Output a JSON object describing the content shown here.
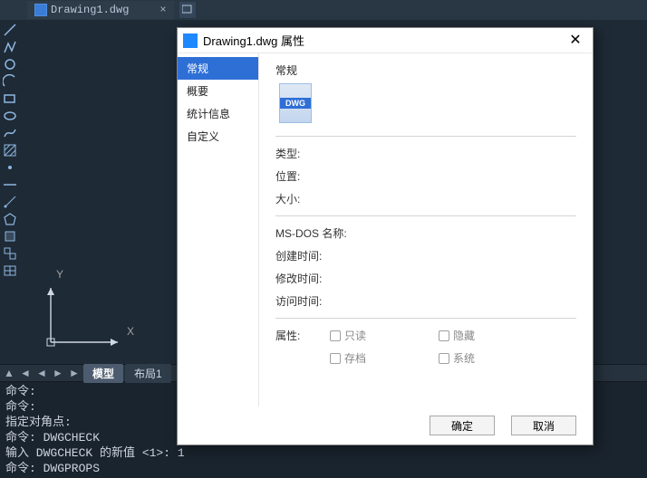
{
  "tabbar": {
    "tab1_label": "Drawing1.dwg"
  },
  "status_tabs": {
    "model_label": "模型",
    "layout1_label": "布局1"
  },
  "axis": {
    "x": "X",
    "y": "Y"
  },
  "cmd": {
    "l1": "命令:",
    "l2": "命令:",
    "l3": "指定对角点:",
    "l4": "命令: DWGCHECK",
    "l5": "输入 DWGCHECK 的新值 <1>: 1",
    "l6": "命令: DWGPROPS"
  },
  "dialog": {
    "title": "Drawing1.dwg 属性",
    "nav": {
      "general": "常规",
      "summary": "概要",
      "statistics": "统计信息",
      "custom": "自定义"
    },
    "pane": {
      "heading": "常规",
      "icon_text": "DWG",
      "type_label": "类型:",
      "location_label": "位置:",
      "size_label": "大小:",
      "msdos_label": "MS-DOS 名称:",
      "created_label": "创建时间:",
      "modified_label": "修改时间:",
      "accessed_label": "访问时间:",
      "attr_label": "属性:",
      "readonly_label": "只读",
      "hidden_label": "隐藏",
      "archive_label": "存档",
      "system_label": "系统"
    },
    "buttons": {
      "ok": "确定",
      "cancel": "取消"
    }
  }
}
